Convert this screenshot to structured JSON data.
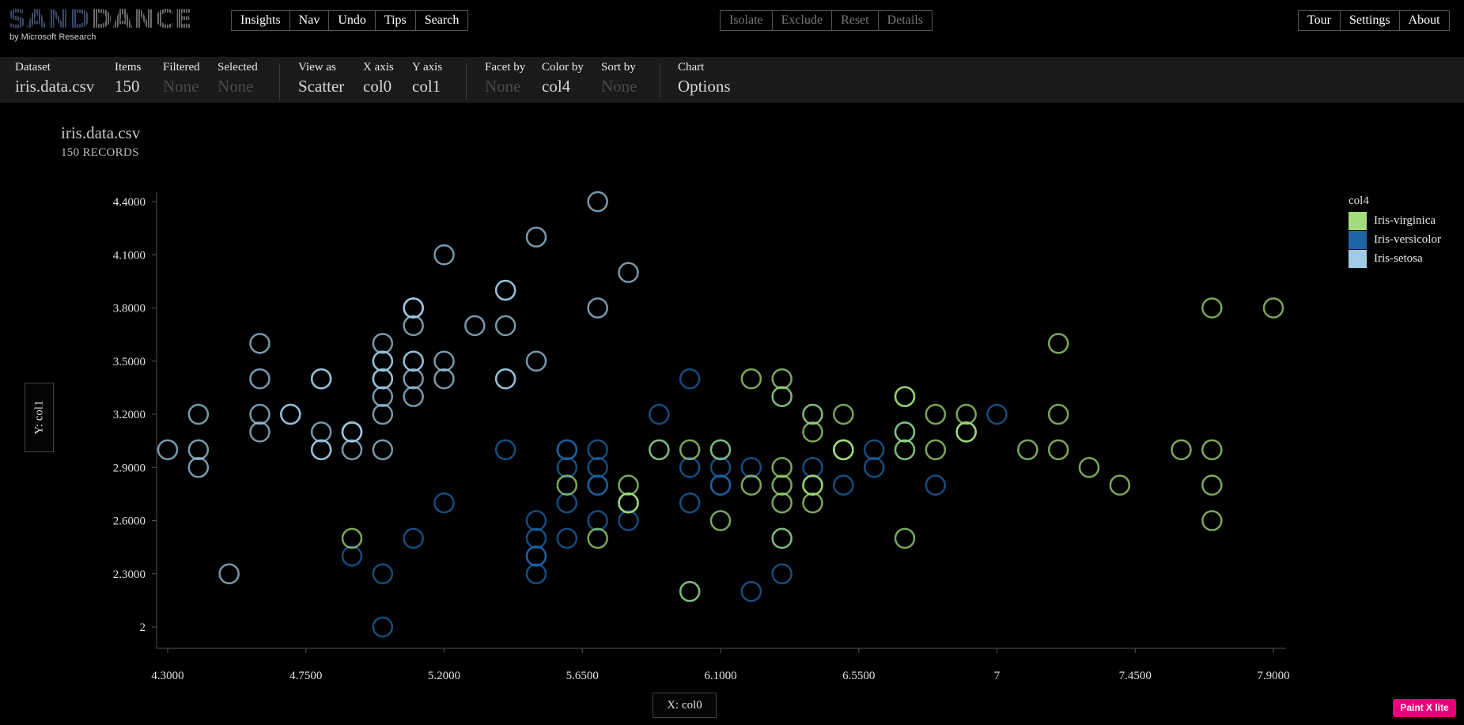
{
  "app": {
    "logo_left": "SAND",
    "logo_right": "DANCE",
    "logo_sub": "by Microsoft Research",
    "brand_color": "#3c4a6a"
  },
  "toolbar": {
    "left": [
      "Insights",
      "Nav",
      "Undo",
      "Tips",
      "Search"
    ],
    "middle": [
      "Isolate",
      "Exclude",
      "Reset",
      "Details"
    ],
    "right": [
      "Tour",
      "Settings",
      "About"
    ]
  },
  "settings": {
    "dataset": {
      "label": "Dataset",
      "value": "iris.data.csv"
    },
    "items": {
      "label": "Items",
      "value": "150"
    },
    "filtered": {
      "label": "Filtered",
      "value": "None"
    },
    "selected": {
      "label": "Selected",
      "value": "None"
    },
    "view_as": {
      "label": "View as",
      "value": "Scatter"
    },
    "x_axis": {
      "label": "X axis",
      "value": "col0"
    },
    "y_axis": {
      "label": "Y axis",
      "value": "col1"
    },
    "facet_by": {
      "label": "Facet by",
      "value": "None"
    },
    "color_by": {
      "label": "Color by",
      "value": "col4"
    },
    "sort_by": {
      "label": "Sort by",
      "value": "None"
    },
    "chart": {
      "label": "Chart",
      "value": "Options"
    }
  },
  "chart_header": {
    "title": "iris.data.csv",
    "subtitle": "150 RECORDS"
  },
  "axis_buttons": {
    "y": "Y: col1",
    "x": "X: col0"
  },
  "badge": {
    "label": "Paint X lite",
    "color": "#e6007a"
  },
  "chart_data": {
    "type": "scatter",
    "xlabel": "X: col0",
    "ylabel": "Y: col1",
    "xlim": [
      4.3,
      7.9
    ],
    "ylim": [
      2,
      4.4
    ],
    "x_ticks": [
      "4.3000",
      "4.7500",
      "5.2000",
      "5.6500",
      "6.1000",
      "6.5500",
      "7",
      "7.4500",
      "7.9000"
    ],
    "y_ticks": [
      "4.4000",
      "4.1000",
      "3.8000",
      "3.5000",
      "3.2000",
      "2.9000",
      "2.6000",
      "2.3000",
      "2"
    ],
    "legend": {
      "title": "col4",
      "placement": "top-right",
      "entries": [
        {
          "name": "Iris-virginica",
          "color": "#a3dd7b"
        },
        {
          "name": "Iris-versicolor",
          "color": "#1f65a8"
        },
        {
          "name": "Iris-setosa",
          "color": "#9fcbe6"
        }
      ]
    },
    "series": [
      {
        "name": "Iris-setosa",
        "color": "#9fcbe6",
        "points": [
          [
            5.1,
            3.5
          ],
          [
            4.9,
            3.0
          ],
          [
            4.7,
            3.2
          ],
          [
            4.6,
            3.1
          ],
          [
            5.0,
            3.6
          ],
          [
            5.4,
            3.9
          ],
          [
            4.6,
            3.4
          ],
          [
            5.0,
            3.4
          ],
          [
            4.4,
            2.9
          ],
          [
            4.9,
            3.1
          ],
          [
            5.4,
            3.7
          ],
          [
            4.8,
            3.4
          ],
          [
            4.8,
            3.0
          ],
          [
            4.3,
            3.0
          ],
          [
            5.8,
            4.0
          ],
          [
            5.7,
            4.4
          ],
          [
            5.4,
            3.9
          ],
          [
            5.1,
            3.5
          ],
          [
            5.7,
            3.8
          ],
          [
            5.1,
            3.8
          ],
          [
            5.4,
            3.4
          ],
          [
            5.1,
            3.7
          ],
          [
            4.6,
            3.6
          ],
          [
            5.1,
            3.3
          ],
          [
            4.8,
            3.4
          ],
          [
            5.0,
            3.0
          ],
          [
            5.0,
            3.4
          ],
          [
            5.2,
            3.5
          ],
          [
            5.2,
            3.4
          ],
          [
            4.7,
            3.2
          ],
          [
            4.8,
            3.1
          ],
          [
            5.4,
            3.4
          ],
          [
            5.2,
            4.1
          ],
          [
            5.5,
            4.2
          ],
          [
            4.9,
            3.1
          ],
          [
            5.0,
            3.2
          ],
          [
            5.5,
            3.5
          ],
          [
            4.9,
            3.1
          ],
          [
            4.4,
            3.0
          ],
          [
            5.1,
            3.4
          ],
          [
            5.0,
            3.5
          ],
          [
            4.5,
            2.3
          ],
          [
            4.4,
            3.2
          ],
          [
            5.0,
            3.5
          ],
          [
            5.1,
            3.8
          ],
          [
            4.8,
            3.0
          ],
          [
            5.1,
            3.8
          ],
          [
            4.6,
            3.2
          ],
          [
            5.3,
            3.7
          ],
          [
            5.0,
            3.3
          ]
        ]
      },
      {
        "name": "Iris-versicolor",
        "color": "#1f65a8",
        "points": [
          [
            7.0,
            3.2
          ],
          [
            6.4,
            3.2
          ],
          [
            6.9,
            3.1
          ],
          [
            5.5,
            2.3
          ],
          [
            6.5,
            2.8
          ],
          [
            5.7,
            2.8
          ],
          [
            6.3,
            3.3
          ],
          [
            4.9,
            2.4
          ],
          [
            6.6,
            2.9
          ],
          [
            5.2,
            2.7
          ],
          [
            5.0,
            2.0
          ],
          [
            5.9,
            3.0
          ],
          [
            6.0,
            2.2
          ],
          [
            6.1,
            2.9
          ],
          [
            5.6,
            2.9
          ],
          [
            6.7,
            3.1
          ],
          [
            5.6,
            3.0
          ],
          [
            5.8,
            2.7
          ],
          [
            6.2,
            2.2
          ],
          [
            5.6,
            2.5
          ],
          [
            5.9,
            3.2
          ],
          [
            6.1,
            2.8
          ],
          [
            6.3,
            2.5
          ],
          [
            6.1,
            2.8
          ],
          [
            6.4,
            2.9
          ],
          [
            6.6,
            3.0
          ],
          [
            6.8,
            2.8
          ],
          [
            6.7,
            3.0
          ],
          [
            6.0,
            2.9
          ],
          [
            5.7,
            2.6
          ],
          [
            5.5,
            2.4
          ],
          [
            5.5,
            2.4
          ],
          [
            5.8,
            2.7
          ],
          [
            6.0,
            2.7
          ],
          [
            5.4,
            3.0
          ],
          [
            6.0,
            3.4
          ],
          [
            6.7,
            3.1
          ],
          [
            6.3,
            2.3
          ],
          [
            5.6,
            3.0
          ],
          [
            5.5,
            2.5
          ],
          [
            5.5,
            2.6
          ],
          [
            6.1,
            3.0
          ],
          [
            5.8,
            2.6
          ],
          [
            5.0,
            2.3
          ],
          [
            5.6,
            2.7
          ],
          [
            5.7,
            3.0
          ],
          [
            5.7,
            2.9
          ],
          [
            6.2,
            2.9
          ],
          [
            5.1,
            2.5
          ],
          [
            5.7,
            2.8
          ]
        ]
      },
      {
        "name": "Iris-virginica",
        "color": "#a3dd7b",
        "points": [
          [
            6.3,
            3.3
          ],
          [
            5.8,
            2.7
          ],
          [
            7.1,
            3.0
          ],
          [
            6.3,
            2.9
          ],
          [
            6.5,
            3.0
          ],
          [
            7.6,
            3.0
          ],
          [
            4.9,
            2.5
          ],
          [
            7.3,
            2.9
          ],
          [
            6.7,
            2.5
          ],
          [
            7.2,
            3.6
          ],
          [
            6.5,
            3.2
          ],
          [
            6.4,
            2.7
          ],
          [
            6.8,
            3.0
          ],
          [
            5.7,
            2.5
          ],
          [
            5.8,
            2.8
          ],
          [
            6.4,
            3.2
          ],
          [
            6.5,
            3.0
          ],
          [
            7.7,
            3.8
          ],
          [
            7.7,
            2.6
          ],
          [
            6.0,
            2.2
          ],
          [
            6.9,
            3.2
          ],
          [
            5.6,
            2.8
          ],
          [
            7.7,
            2.8
          ],
          [
            6.3,
            2.7
          ],
          [
            6.7,
            3.3
          ],
          [
            7.2,
            3.2
          ],
          [
            6.2,
            2.8
          ],
          [
            6.1,
            3.0
          ],
          [
            6.4,
            2.8
          ],
          [
            7.2,
            3.0
          ],
          [
            7.4,
            2.8
          ],
          [
            7.9,
            3.8
          ],
          [
            6.4,
            2.8
          ],
          [
            6.3,
            2.8
          ],
          [
            6.1,
            2.6
          ],
          [
            7.7,
            3.0
          ],
          [
            6.3,
            3.4
          ],
          [
            6.4,
            3.1
          ],
          [
            6.0,
            3.0
          ],
          [
            6.9,
            3.1
          ],
          [
            6.7,
            3.1
          ],
          [
            6.9,
            3.1
          ],
          [
            5.8,
            2.7
          ],
          [
            6.8,
            3.2
          ],
          [
            6.7,
            3.3
          ],
          [
            6.7,
            3.0
          ],
          [
            6.3,
            2.5
          ],
          [
            6.5,
            3.0
          ],
          [
            6.2,
            3.4
          ],
          [
            5.9,
            3.0
          ]
        ]
      }
    ]
  }
}
